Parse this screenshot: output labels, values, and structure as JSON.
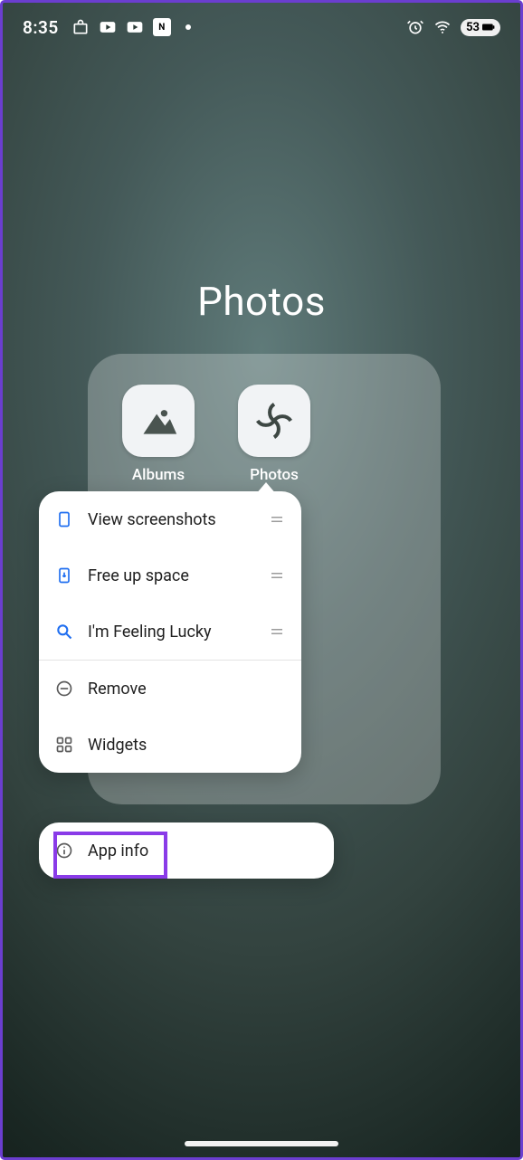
{
  "statusbar": {
    "time": "8:35",
    "batteryPercent": "53",
    "signalChip": "N"
  },
  "folder": {
    "title": "Photos"
  },
  "apps": {
    "albums": {
      "label": "Albums"
    },
    "photos": {
      "label": "Photos"
    }
  },
  "menu": {
    "viewScreenshots": "View screenshots",
    "freeUpSpace": "Free up space",
    "feelingLucky": "I'm Feeling Lucky",
    "remove": "Remove",
    "widgets": "Widgets",
    "appInfo": "App info"
  }
}
